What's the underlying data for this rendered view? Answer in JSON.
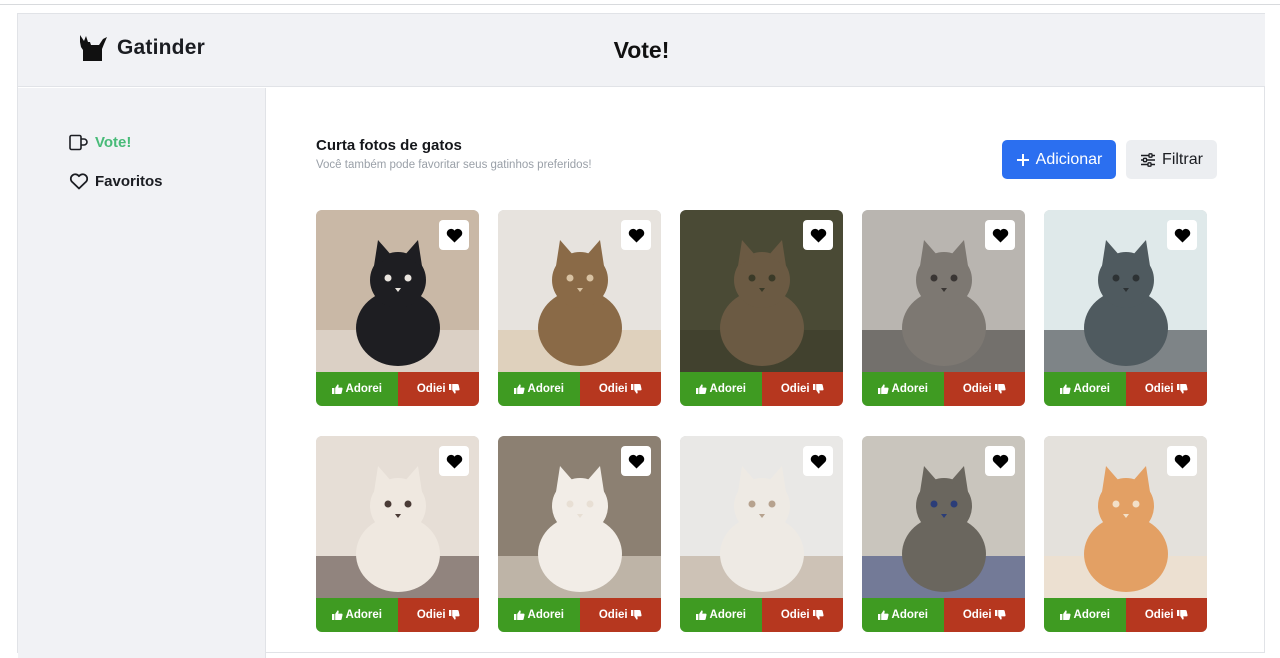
{
  "brand": {
    "name": "Gatinder",
    "logo_icon": "cat-silhouette-icon"
  },
  "header": {
    "title": "Vote!"
  },
  "sidebar": {
    "items": [
      {
        "label": "Vote!",
        "icon": "mug-icon",
        "active": true
      },
      {
        "label": "Favoritos",
        "icon": "heart-outline-icon",
        "active": false
      }
    ]
  },
  "main": {
    "title": "Curta fotos de gatos",
    "subtitle": "Você também pode favoritar seus gatinhos preferidos!",
    "add_label": "Adicionar",
    "filter_label": "Filtrar"
  },
  "card_labels": {
    "like": "Adorei",
    "dislike": "Odiei"
  },
  "cats": [
    {
      "id": "cat-1",
      "bg": "#c9b8a6",
      "body": "#1e1e22",
      "accent": "#e9e4de"
    },
    {
      "id": "cat-2",
      "bg": "#e7e3de",
      "body": "#8a6a47",
      "accent": "#d8c2a2"
    },
    {
      "id": "cat-3",
      "bg": "#4a4a35",
      "body": "#6b5a43",
      "accent": "#3a3a28"
    },
    {
      "id": "cat-4",
      "bg": "#b9b5b0",
      "body": "#7d7872",
      "accent": "#3a3634"
    },
    {
      "id": "cat-5",
      "bg": "#dfe9ea",
      "body": "#4f5a5f",
      "accent": "#2d3234"
    },
    {
      "id": "cat-6",
      "bg": "#e6ded6",
      "body": "#efe8e0",
      "accent": "#4a3b36"
    },
    {
      "id": "cat-7",
      "bg": "#8c8072",
      "body": "#f2ede7",
      "accent": "#e8dfd4"
    },
    {
      "id": "cat-8",
      "bg": "#e9e8e6",
      "body": "#eeeae4",
      "accent": "#b6a28e"
    },
    {
      "id": "cat-9",
      "bg": "#c9c5bd",
      "body": "#6a665e",
      "accent": "#2b3d78"
    },
    {
      "id": "cat-10",
      "bg": "#e4e1dc",
      "body": "#e3a064",
      "accent": "#f3e0c8"
    }
  ],
  "colors": {
    "accent_green": "#48bb78",
    "add_button": "#2b6ff0",
    "like": "#3f9b22",
    "dislike": "#b6371f"
  }
}
